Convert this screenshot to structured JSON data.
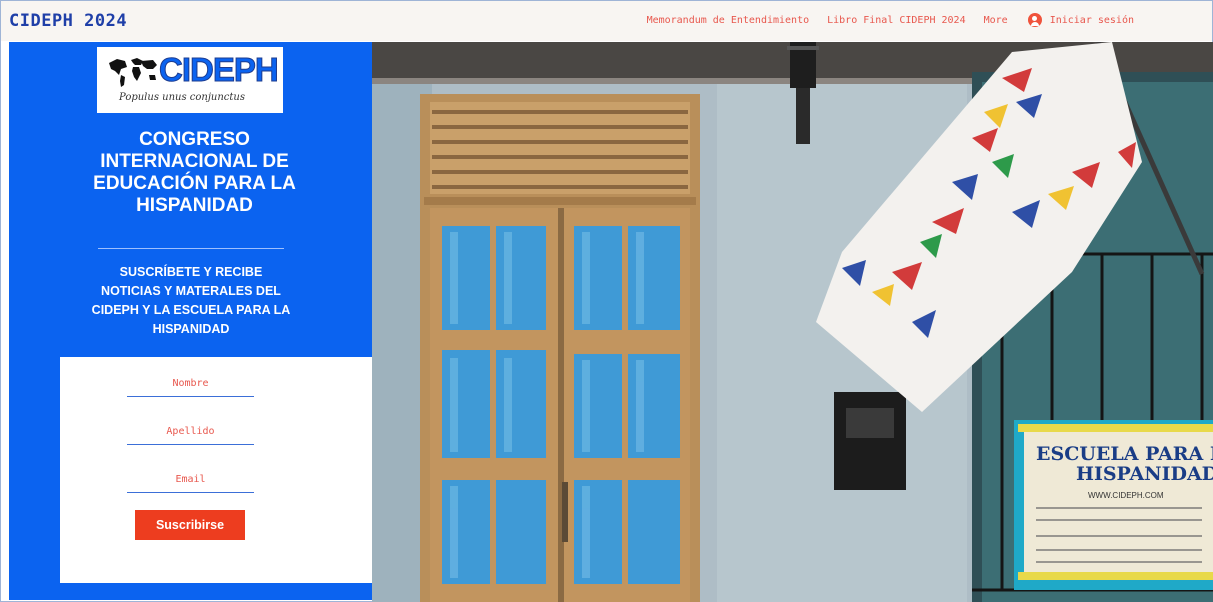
{
  "header": {
    "site_title": "CIDEPH 2024",
    "nav": [
      {
        "label": "Memorandum de Entendimiento"
      },
      {
        "label": "Libro Final CIDEPH 2024"
      },
      {
        "label": "More"
      }
    ],
    "login_label": "Iniciar sesión",
    "login_icon": "user-account-icon"
  },
  "panel": {
    "logo_text": "CIDEPH",
    "logo_motto": "Populus unus conjunctus",
    "title": "CONGRESO INTERNACIONAL DE EDUCACIÓN PARA LA HISPANIDAD",
    "subscribe_text": "SUSCRÍBETE Y RECIBE NOTICIAS Y MATERALES DEL CIDEPH Y LA ESCUELA PARA LA HISPANIDAD"
  },
  "form": {
    "first_name_placeholder": "Nombre",
    "last_name_placeholder": "Apellido",
    "email_placeholder": "Email",
    "submit_label": "Suscribirse"
  },
  "photo": {
    "sign_title_line1": "ESCUELA PARA LA",
    "sign_title_line2": "HISPANIDAD",
    "sign_url": "WWW.CIDEPH.COM"
  },
  "colors": {
    "brand_blue": "#0b63f0",
    "accent_red": "#ed3d1f",
    "nav_text": "#e8584e",
    "title_blue": "#1f3fa8"
  }
}
